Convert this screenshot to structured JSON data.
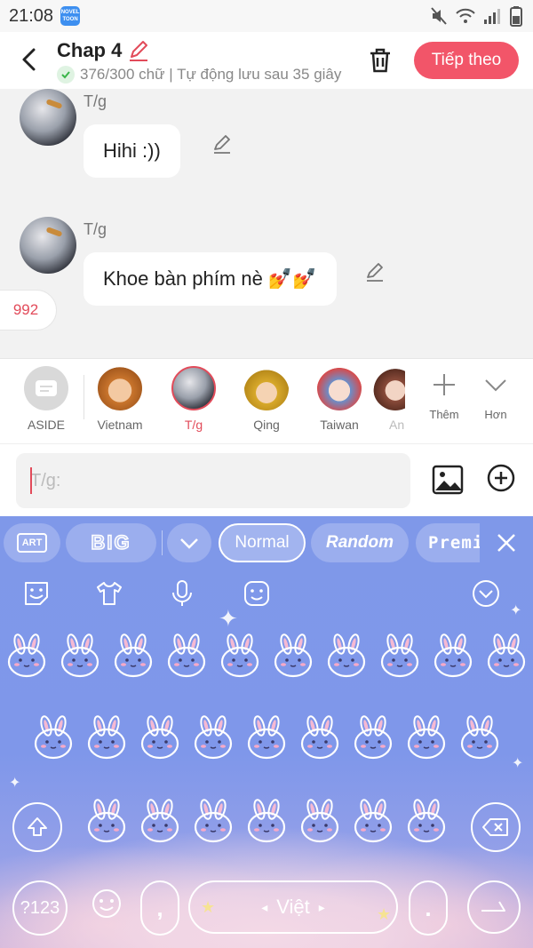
{
  "status_bar": {
    "time": "21:08",
    "badge_line1": "NOVEL",
    "badge_line2": "TOON"
  },
  "header": {
    "title": "Chap 4",
    "subtitle": "376/300 chữ | Tự động lưu sau 35 giây",
    "next_label": "Tiếp theo"
  },
  "messages": [
    {
      "speaker": "T/g",
      "text": "Hihi :))"
    },
    {
      "speaker": "T/g",
      "text": "Khoe bàn phím nè 💅💅"
    }
  ],
  "count_badge": "992",
  "characters": [
    {
      "label": "ASIDE"
    },
    {
      "label": "Vietnam"
    },
    {
      "label": "T/g"
    },
    {
      "label": "Qing"
    },
    {
      "label": "Taiwan"
    },
    {
      "label": "An"
    }
  ],
  "actions": {
    "more_label": "Thêm",
    "expand_label": "Hơn"
  },
  "input": {
    "placeholder": "T/g:"
  },
  "keyboard": {
    "tools": {
      "art": "ART",
      "big": "BIG",
      "normal": "Normal",
      "random": "Random",
      "premium": "Premium"
    },
    "numbers_key": "?123",
    "comma_key": ",",
    "period_key": ".",
    "language": "Việt"
  },
  "colors": {
    "accent": "#f25569",
    "keyboard_bg": "#7f98e9"
  }
}
